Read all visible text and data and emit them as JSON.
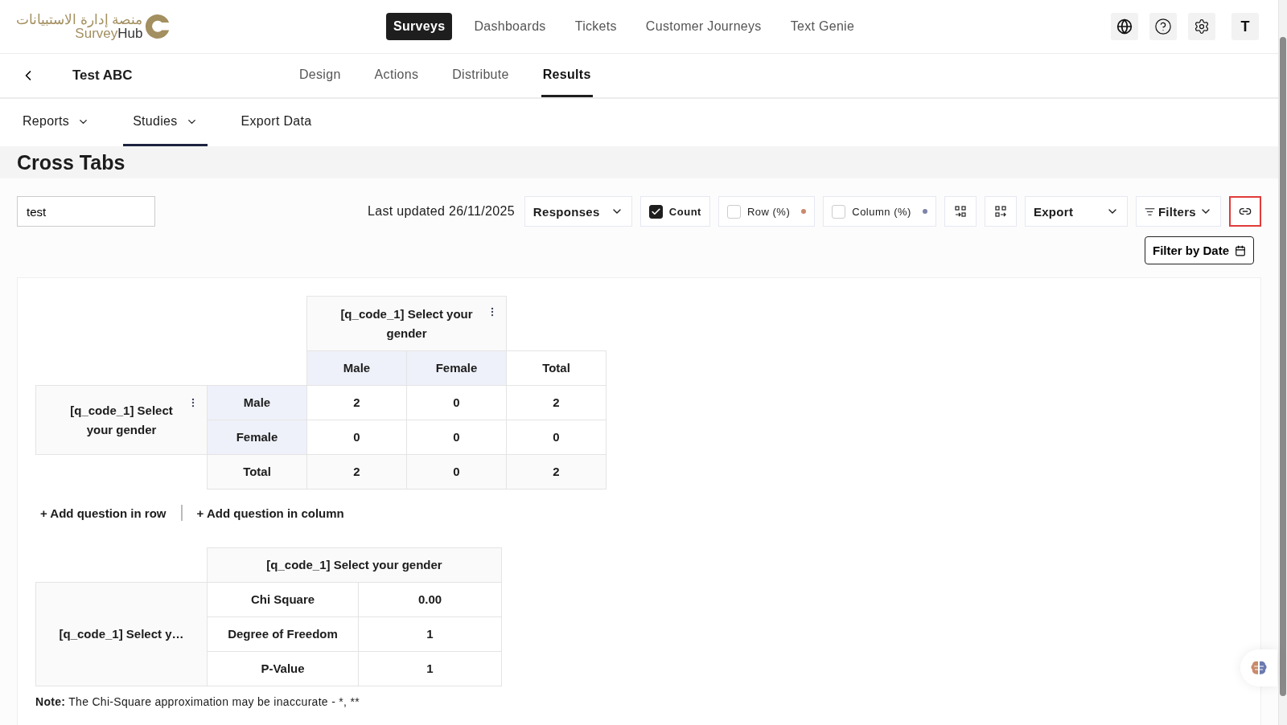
{
  "logo": {
    "arabic": "منصة إدارة الاستبيانات",
    "name_first": "Survey",
    "name_second": "Hub"
  },
  "main_nav": [
    {
      "label": "Surveys",
      "selected": true
    },
    {
      "label": "Dashboards",
      "selected": false
    },
    {
      "label": "Tickets",
      "selected": false
    },
    {
      "label": "Customer Journeys",
      "selected": false
    },
    {
      "label": "Text Genie",
      "selected": false
    }
  ],
  "avatar": "T",
  "survey_title": "Test ABC",
  "survey_tabs": [
    {
      "label": "Design",
      "selected": false
    },
    {
      "label": "Actions",
      "selected": false
    },
    {
      "label": "Distribute",
      "selected": false
    },
    {
      "label": "Results",
      "selected": true
    }
  ],
  "results_tabs": [
    {
      "label": "Reports",
      "dropdown": true,
      "selected": false
    },
    {
      "label": "Studies",
      "dropdown": true,
      "selected": true
    },
    {
      "label": "Export Data",
      "dropdown": false,
      "selected": false
    }
  ],
  "page_title": "Cross Tabs",
  "toolbar": {
    "search_value": "test",
    "last_updated": "Last updated 26/11/2025",
    "measure": "Responses",
    "toggles": [
      {
        "label": "Count",
        "checked": true
      },
      {
        "label": "Row (%)",
        "checked": false,
        "color": "#c98a6b"
      },
      {
        "label": "Column (%)",
        "checked": false,
        "color": "#7f84a8"
      }
    ],
    "export": "Export",
    "filters": "Filters",
    "link_highlighted": true,
    "filter_by_date": "Filter by Date"
  },
  "cross_table": {
    "column_question": "[q_code_1] Select your gender",
    "row_question": "[q_code_1] Select your gender",
    "columns": [
      {
        "label": "Male",
        "kind": "category"
      },
      {
        "label": "Female",
        "kind": "category"
      },
      {
        "label": "Total",
        "kind": "total"
      }
    ],
    "rows": [
      {
        "label": "Male",
        "kind": "category",
        "cells": [
          "2",
          "0",
          "2"
        ]
      },
      {
        "label": "Female",
        "kind": "category",
        "cells": [
          "0",
          "0",
          "0"
        ]
      },
      {
        "label": "Total",
        "kind": "total",
        "cells": [
          "2",
          "0",
          "2"
        ]
      }
    ]
  },
  "add_links": [
    "+ Add question in row",
    "+ Add question in column"
  ],
  "chi_table": {
    "column_question": "[q_code_1] Select your gender",
    "row_question": "[q_code_1] Select y…",
    "rows": [
      {
        "label": "Chi Square",
        "value": "0.00"
      },
      {
        "label": "Degree of Freedom",
        "value": "1"
      },
      {
        "label": "P-Value",
        "value": "1"
      }
    ]
  },
  "note": "**Note:** The Chi-Square approximation may be inaccurate - *, **"
}
